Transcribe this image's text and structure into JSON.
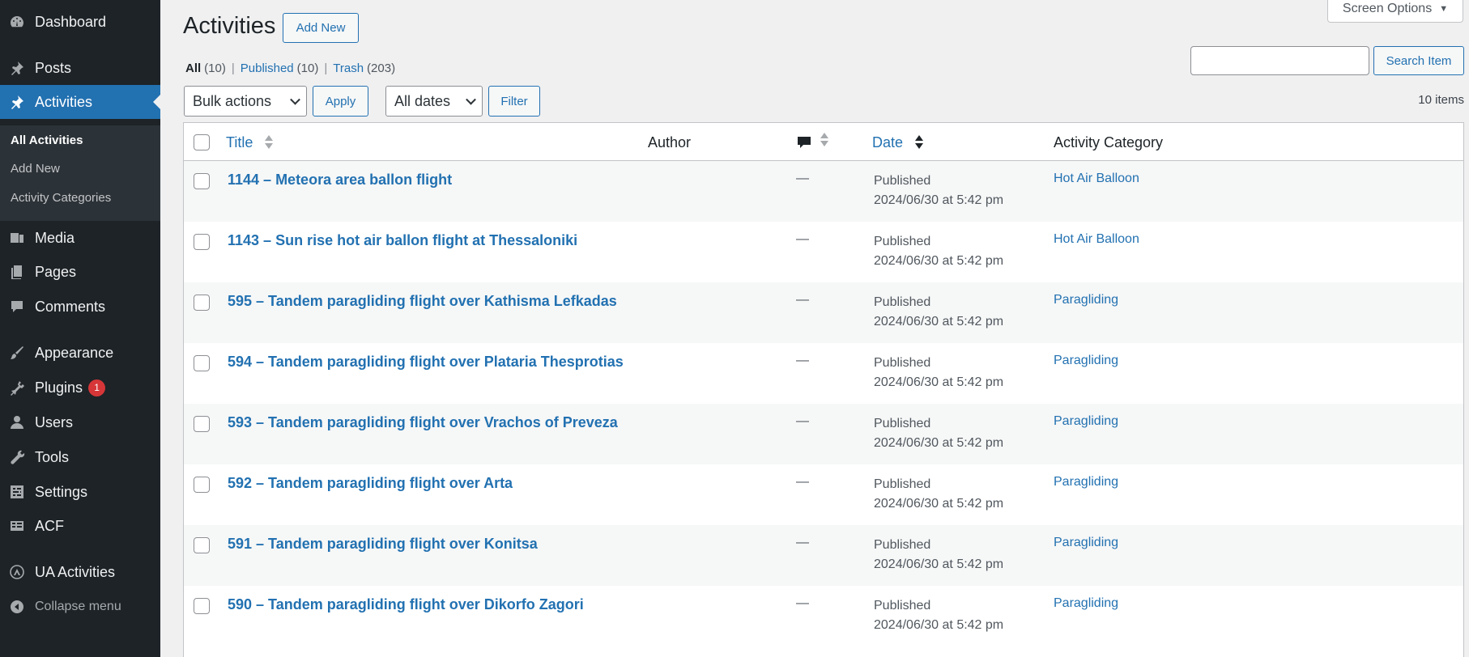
{
  "sidebar": {
    "items": [
      {
        "label": "Dashboard",
        "icon": "dashboard-icon"
      },
      {
        "label": "Posts",
        "icon": "pin-icon"
      },
      {
        "label": "Activities",
        "icon": "pin-icon"
      },
      {
        "label": "Media",
        "icon": "media-icon"
      },
      {
        "label": "Pages",
        "icon": "pages-icon"
      },
      {
        "label": "Comments",
        "icon": "comment-icon"
      },
      {
        "label": "Appearance",
        "icon": "brush-icon"
      },
      {
        "label": "Plugins",
        "icon": "plug-icon",
        "badge": "1"
      },
      {
        "label": "Users",
        "icon": "user-icon"
      },
      {
        "label": "Tools",
        "icon": "wrench-icon"
      },
      {
        "label": "Settings",
        "icon": "settings-icon"
      },
      {
        "label": "ACF",
        "icon": "acf-icon"
      },
      {
        "label": "UA Activities",
        "icon": "ua-icon"
      },
      {
        "label": "Collapse menu",
        "icon": "collapse-icon"
      }
    ],
    "submenu": [
      "All Activities",
      "Add New",
      "Activity Categories"
    ]
  },
  "header": {
    "title": "Activities",
    "add_new": "Add New",
    "screen_options": "Screen Options"
  },
  "views": {
    "all": {
      "label": "All",
      "count": "(10)"
    },
    "published": {
      "label": "Published",
      "count": "(10)"
    },
    "trash": {
      "label": "Trash",
      "count": "(203)"
    },
    "sep": "|"
  },
  "search": {
    "button": "Search Item",
    "value": ""
  },
  "filters": {
    "bulk_actions": "Bulk actions",
    "apply": "Apply",
    "dates": "All dates",
    "filter": "Filter",
    "items_count": "10 items"
  },
  "table": {
    "columns": {
      "title": "Title",
      "author": "Author",
      "date": "Date",
      "category": "Activity Category"
    },
    "rows": [
      {
        "title": "1144 – Meteora area ballon flight",
        "comments": "—",
        "status": "Published",
        "date": "2024/06/30 at 5:42 pm",
        "category": "Hot Air Balloon"
      },
      {
        "title": "1143 – Sun rise hot air ballon flight at Thessaloniki",
        "comments": "—",
        "status": "Published",
        "date": "2024/06/30 at 5:42 pm",
        "category": "Hot Air Balloon"
      },
      {
        "title": "595 – Tandem paragliding flight over Kathisma Lefkadas",
        "comments": "—",
        "status": "Published",
        "date": "2024/06/30 at 5:42 pm",
        "category": "Paragliding"
      },
      {
        "title": "594 – Tandem paragliding flight over Plataria Thesprotias",
        "comments": "—",
        "status": "Published",
        "date": "2024/06/30 at 5:42 pm",
        "category": "Paragliding"
      },
      {
        "title": "593 – Tandem paragliding flight over Vrachos of Preveza",
        "comments": "—",
        "status": "Published",
        "date": "2024/06/30 at 5:42 pm",
        "category": "Paragliding"
      },
      {
        "title": "592 – Tandem paragliding flight over Arta",
        "comments": "—",
        "status": "Published",
        "date": "2024/06/30 at 5:42 pm",
        "category": "Paragliding"
      },
      {
        "title": "591 – Tandem paragliding flight over Konitsa",
        "comments": "—",
        "status": "Published",
        "date": "2024/06/30 at 5:42 pm",
        "category": "Paragliding"
      },
      {
        "title": "590 – Tandem paragliding flight over Dikorfo Zagori",
        "comments": "—",
        "status": "Published",
        "date": "2024/06/30 at 5:42 pm",
        "category": "Paragliding"
      }
    ]
  },
  "colors": {
    "sidebar_bg": "#1d2327",
    "accent": "#2271b1",
    "badge": "#d63638"
  }
}
